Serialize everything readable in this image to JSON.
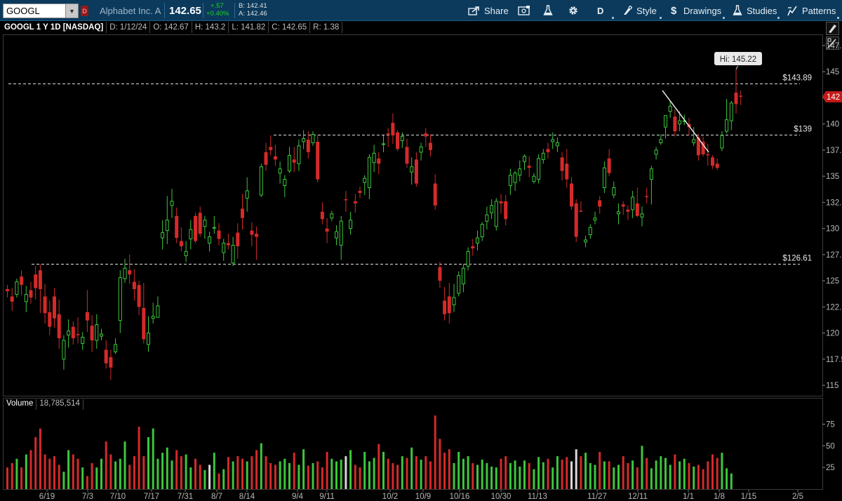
{
  "toolbar": {
    "symbol": "GOOGL",
    "dividend_flag": "D",
    "company": "Alphabet Inc. A",
    "last_price": "142.65",
    "net_change": "+.57",
    "net_change_pct": "+0.40%",
    "bid": "B: 142.41",
    "ask": "A: 142.46",
    "share_label": "Share",
    "aggregation_label": "D",
    "style_label": "Style",
    "drawings_label": "Drawings",
    "studies_label": "Studies",
    "patterns_label": "Patterns",
    "icons": [
      "share-icon",
      "screenshot-icon",
      "flask-icon",
      "gear-icon",
      "style-icon",
      "drawings-icon",
      "studies-icon",
      "patterns-icon"
    ]
  },
  "infobar": {
    "title": "GOOGL 1 Y 1D [NASDAQ]",
    "date": "D: 1/12/24",
    "open": "O: 142.67",
    "high": "H: 143.2",
    "low": "L: 141.82",
    "close": "C: 142.65",
    "range": "R: 1.38"
  },
  "volume_panel": {
    "title": "Volume",
    "value": "18,785,514"
  },
  "colors": {
    "up": "#3dc63d",
    "down": "#d42a2a",
    "neutral": "#d8d8d8",
    "toolbar_bg": "#0b3a5c",
    "last_price_bubble": "#c41919"
  },
  "chart_data": {
    "type": "candlestick",
    "symbol": "GOOGL",
    "period": "1 Y 1D",
    "y_axis": {
      "min": 114,
      "max": 148.5,
      "ticks": [
        115,
        117.5,
        120,
        122.5,
        125,
        127.5,
        130,
        132.5,
        135,
        137.5,
        140,
        142.5,
        145,
        147.5
      ],
      "tick_labels": [
        "115",
        "117.5",
        "120",
        "122.5",
        "125",
        "127.5",
        "130",
        "132.5",
        "135",
        "137.5",
        "140",
        "142",
        "145",
        "147.5"
      ]
    },
    "x_axis": {
      "labels": [
        "6/19",
        "7/3",
        "7/10",
        "7/17",
        "7/31",
        "8/7",
        "8/14",
        "9/4",
        "9/11",
        "10/2",
        "10/9",
        "10/16",
        "10/30",
        "11/13",
        "11/27",
        "12/11",
        "1/1",
        "1/8",
        "1/15",
        "2/5"
      ]
    },
    "volume_axis": {
      "ticks": [
        25,
        50,
        75
      ],
      "max": 90
    },
    "horizontal_lines": [
      {
        "price": 143.89,
        "label": "$143.89"
      },
      {
        "price": 139,
        "label": "$139"
      },
      {
        "price": 126.61,
        "label": "$126.61"
      }
    ],
    "high_marker": {
      "label": "Hi: 145.22",
      "price": 145.22
    },
    "last_price_label": "142",
    "trendline": {
      "from": {
        "date": "12/14",
        "price": 143.2
      },
      "to": {
        "date": "1/2",
        "price": 137.3
      }
    },
    "candles_ohlc": [
      [
        124.2,
        124.6,
        123.4,
        124.0
      ],
      [
        123.5,
        124.3,
        122.1,
        123.0
      ],
      [
        123.7,
        125.2,
        123.4,
        124.9
      ],
      [
        125.4,
        126.0,
        123.6,
        124.6
      ],
      [
        123.0,
        124.5,
        122.0,
        123.7
      ],
      [
        124.1,
        124.9,
        122.8,
        123.4
      ],
      [
        125.6,
        126.4,
        123.2,
        124.3
      ],
      [
        126.0,
        126.6,
        121.9,
        124.2
      ],
      [
        123.5,
        124.7,
        120.9,
        121.9
      ],
      [
        122.0,
        123.1,
        119.8,
        120.6
      ],
      [
        123.5,
        124.3,
        120.5,
        121.4
      ],
      [
        121.8,
        123.2,
        118.5,
        119.5
      ],
      [
        117.5,
        119.8,
        116.5,
        119.3
      ],
      [
        119.8,
        121.3,
        118.6,
        120.2
      ],
      [
        120.6,
        121.1,
        118.9,
        119.5
      ],
      [
        119.9,
        121.5,
        119.0,
        119.8
      ],
      [
        119.0,
        120.1,
        118.4,
        119.6
      ],
      [
        122.0,
        124.1,
        120.1,
        121.2
      ],
      [
        120.7,
        121.7,
        118.2,
        119.3
      ],
      [
        119.3,
        121.8,
        118.5,
        120.8
      ],
      [
        119.7,
        120.4,
        119.3,
        119.9
      ],
      [
        118.4,
        119.3,
        116.6,
        117.1
      ],
      [
        117.7,
        118.4,
        115.5,
        116.7
      ],
      [
        118.2,
        119.5,
        118.0,
        118.9
      ],
      [
        121.2,
        126.0,
        120.0,
        125.3
      ],
      [
        125.2,
        127.1,
        124.8,
        126.2
      ],
      [
        126.0,
        127.5,
        124.7,
        125.6
      ],
      [
        124.9,
        126.1,
        123.1,
        124.2
      ],
      [
        124.6,
        125.0,
        121.7,
        122.5
      ],
      [
        122.4,
        124.8,
        119.0,
        119.4
      ],
      [
        118.9,
        121.6,
        118.2,
        120.0
      ],
      [
        121.4,
        122.9,
        120.9,
        121.6
      ],
      [
        121.5,
        123.5,
        121.5,
        122.6
      ],
      [
        129.1,
        130.8,
        128.0,
        129.6
      ],
      [
        129.8,
        133.1,
        128.5,
        130.8
      ],
      [
        132.2,
        133.8,
        131.0,
        132.6
      ],
      [
        131.2,
        132.0,
        128.6,
        129.1
      ],
      [
        128.8,
        130.1,
        127.8,
        128.3
      ],
      [
        127.4,
        128.8,
        126.8,
        127.8
      ],
      [
        129.0,
        130.8,
        128.0,
        129.9
      ],
      [
        131.2,
        131.5,
        128.6,
        128.8
      ],
      [
        131.5,
        132.1,
        129.2,
        129.5
      ],
      [
        130.2,
        131.2,
        129.0,
        130.8
      ],
      [
        128.6,
        129.7,
        127.8,
        129.2
      ],
      [
        130.1,
        131.2,
        129.5,
        130.1
      ],
      [
        129.8,
        130.5,
        128.4,
        129.0
      ],
      [
        127.7,
        129.0,
        126.9,
        128.6
      ],
      [
        128.6,
        129.5,
        128.0,
        128.4
      ],
      [
        126.7,
        129.2,
        126.4,
        128.4
      ],
      [
        129.6,
        130.5,
        127.1,
        128.3
      ],
      [
        131.9,
        133.3,
        129.9,
        131.0
      ],
      [
        132.9,
        134.9,
        131.6,
        133.6
      ],
      [
        129.8,
        130.6,
        128.3,
        129.4
      ],
      [
        129.5,
        130.2,
        127.0,
        129.2
      ],
      [
        133.2,
        136.2,
        133.0,
        135.9
      ],
      [
        137.3,
        138.2,
        135.5,
        136.1
      ],
      [
        137.8,
        138.9,
        137.0,
        137.5
      ],
      [
        136.9,
        138.0,
        136.0,
        136.6
      ],
      [
        135.3,
        136.4,
        134.3,
        135.7
      ],
      [
        134.1,
        135.1,
        133.0,
        134.7
      ],
      [
        135.5,
        137.8,
        135.3,
        137.0
      ],
      [
        136.6,
        137.8,
        135.4,
        136.3
      ],
      [
        136.2,
        138.5,
        135.5,
        137.9
      ],
      [
        138.3,
        139.4,
        137.6,
        138.6
      ],
      [
        138.5,
        139.3,
        136.7,
        137.3
      ],
      [
        138.2,
        139.3,
        137.9,
        139.0
      ],
      [
        138.3,
        138.9,
        134.4,
        134.7
      ],
      [
        131.6,
        132.5,
        130.4,
        130.9
      ],
      [
        130.0,
        131.0,
        128.6,
        129.7
      ],
      [
        131.0,
        131.7,
        130.7,
        131.4
      ],
      [
        129.1,
        130.3,
        128.4,
        129.7
      ],
      [
        128.4,
        131.2,
        127.0,
        130.7
      ],
      [
        132.8,
        133.6,
        131.6,
        132.7
      ],
      [
        130.0,
        131.6,
        129.4,
        130.8
      ],
      [
        132.6,
        133.3,
        131.5,
        132.4
      ],
      [
        133.6,
        134.0,
        132.9,
        133.4
      ],
      [
        134.4,
        135.1,
        133.2,
        134.8
      ],
      [
        133.9,
        137.1,
        132.8,
        136.8
      ],
      [
        136.3,
        138.0,
        135.4,
        137.2
      ],
      [
        136.7,
        137.3,
        135.2,
        136.2
      ],
      [
        138.1,
        138.9,
        137.3,
        138.1
      ],
      [
        139.1,
        139.6,
        137.8,
        139.0
      ],
      [
        140.1,
        141.0,
        138.1,
        138.9
      ],
      [
        139.2,
        139.4,
        137.4,
        137.6
      ],
      [
        138.4,
        139.2,
        137.7,
        138.8
      ],
      [
        137.8,
        138.6,
        135.8,
        136.2
      ],
      [
        135.4,
        136.8,
        134.2,
        135.9
      ],
      [
        136.6,
        137.3,
        134.0,
        134.3
      ],
      [
        137.3,
        138.2,
        136.5,
        137.8
      ],
      [
        139.1,
        139.6,
        137.8,
        138.8
      ],
      [
        138.2,
        139.0,
        136.9,
        137.5
      ],
      [
        134.3,
        135.2,
        131.8,
        132.2
      ],
      [
        126.3,
        126.8,
        124.3,
        125.0
      ],
      [
        123.1,
        124.4,
        121.2,
        121.8
      ],
      [
        123.5,
        124.8,
        120.9,
        121.9
      ],
      [
        122.7,
        124.7,
        122.0,
        123.4
      ],
      [
        123.8,
        125.9,
        123.5,
        125.5
      ],
      [
        124.7,
        126.6,
        123.9,
        126.2
      ],
      [
        126.4,
        128.2,
        126.0,
        127.8
      ],
      [
        128.3,
        129.0,
        127.4,
        128.1
      ],
      [
        128.6,
        129.8,
        127.9,
        129.1
      ],
      [
        129.2,
        130.6,
        128.8,
        130.4
      ],
      [
        130.7,
        132.1,
        129.9,
        131.3
      ],
      [
        131.5,
        132.8,
        130.9,
        132.2
      ],
      [
        130.2,
        132.9,
        129.8,
        132.6
      ],
      [
        132.6,
        133.3,
        131.4,
        132.4
      ],
      [
        132.6,
        133.2,
        130.3,
        130.9
      ],
      [
        134.1,
        135.7,
        133.2,
        135.1
      ],
      [
        134.4,
        135.5,
        133.6,
        135.3
      ],
      [
        135.1,
        136.5,
        134.5,
        135.7
      ],
      [
        136.4,
        137.1,
        135.6,
        136.9
      ],
      [
        136.0,
        136.9,
        134.9,
        135.8
      ],
      [
        134.5,
        135.3,
        134.3,
        135.0
      ],
      [
        134.7,
        137.1,
        134.3,
        136.7
      ],
      [
        136.6,
        137.6,
        136.2,
        137.2
      ],
      [
        137.6,
        138.2,
        136.7,
        137.3
      ],
      [
        138.3,
        139.2,
        137.6,
        138.5
      ],
      [
        137.9,
        138.7,
        137.3,
        138.2
      ],
      [
        136.8,
        137.3,
        134.6,
        135.5
      ],
      [
        136.2,
        137.6,
        133.9,
        134.7
      ],
      [
        134.3,
        134.9,
        131.8,
        132.1
      ],
      [
        132.4,
        132.8,
        128.7,
        129.2
      ],
      [
        131.7,
        132.6,
        131.6,
        131.6
      ],
      [
        128.7,
        129.3,
        128.2,
        128.9
      ],
      [
        129.4,
        130.4,
        129.0,
        130.1
      ],
      [
        130.8,
        131.6,
        130.4,
        131.0
      ],
      [
        132.7,
        133.1,
        131.4,
        132.1
      ],
      [
        133.9,
        136.4,
        133.4,
        135.8
      ],
      [
        136.7,
        137.6,
        135.0,
        135.3
      ],
      [
        133.2,
        134.5,
        132.9,
        133.9
      ],
      [
        131.4,
        132.4,
        130.4,
        131.6
      ],
      [
        132.3,
        132.6,
        131.3,
        132.1
      ],
      [
        131.8,
        132.2,
        130.8,
        131.6
      ],
      [
        131.8,
        133.6,
        131.0,
        133.0
      ],
      [
        132.4,
        133.9,
        131.1,
        131.2
      ],
      [
        131.1,
        132.1,
        130.2,
        131.4
      ],
      [
        133.1,
        133.9,
        132.4,
        133.0
      ],
      [
        134.7,
        136.0,
        132.3,
        135.7
      ],
      [
        137.1,
        137.8,
        136.6,
        137.5
      ],
      [
        138.2,
        139.0,
        138.0,
        138.5
      ],
      [
        139.7,
        140.8,
        138.6,
        140.8
      ],
      [
        141.2,
        142.2,
        140.6,
        141.7
      ],
      [
        140.7,
        141.4,
        138.8,
        139.3
      ],
      [
        140.0,
        141.2,
        139.3,
        140.3
      ],
      [
        140.3,
        140.9,
        139.9,
        140.3
      ],
      [
        140.0,
        140.6,
        138.9,
        139.7
      ],
      [
        138.2,
        139.7,
        137.9,
        138.5
      ],
      [
        138.7,
        139.0,
        136.5,
        137.0
      ],
      [
        138.3,
        138.8,
        136.9,
        137.1
      ],
      [
        137.1,
        138.1,
        136.0,
        137.0
      ],
      [
        136.8,
        137.0,
        135.7,
        136.0
      ],
      [
        136.2,
        136.7,
        135.6,
        135.8
      ],
      [
        137.7,
        139.3,
        137.4,
        138.9
      ],
      [
        139.3,
        142.4,
        139.1,
        140.4
      ],
      [
        140.3,
        142.2,
        139.4,
        142.0
      ],
      [
        143.0,
        145.2,
        141.0,
        141.9
      ],
      [
        142.7,
        143.2,
        141.8,
        142.6
      ]
    ],
    "volumes_m": [
      25,
      30,
      35,
      25,
      40,
      45,
      60,
      70,
      40,
      35,
      38,
      28,
      20,
      45,
      40,
      35,
      25,
      15,
      30,
      25,
      35,
      55,
      40,
      32,
      35,
      55,
      28,
      38,
      72,
      38,
      60,
      70,
      35,
      42,
      48,
      33,
      45,
      38,
      40,
      25,
      35,
      28,
      22,
      28,
      42,
      18,
      23,
      37,
      32,
      38,
      35,
      32,
      38,
      45,
      53,
      38,
      30,
      28,
      32,
      35,
      30,
      42,
      28,
      46,
      27,
      30,
      32,
      25,
      43,
      35,
      32,
      34,
      38,
      45,
      28,
      25,
      43,
      32,
      36,
      52,
      43,
      35,
      30,
      28,
      38,
      36,
      48,
      38,
      34,
      38,
      32,
      85,
      58,
      42,
      46,
      30,
      43,
      35,
      38,
      30,
      28,
      34,
      30,
      26,
      25,
      35,
      38,
      30,
      33,
      26,
      33,
      30,
      23,
      37,
      31,
      35,
      25,
      38,
      34,
      37,
      32,
      46,
      38,
      42,
      30,
      28,
      43,
      32,
      32,
      25,
      28,
      38,
      30,
      33,
      25,
      50,
      36,
      24,
      33,
      38,
      36,
      28,
      40,
      32,
      35,
      30,
      26,
      28,
      23,
      32,
      40,
      36,
      42,
      24,
      18
    ],
    "volume_white_indices": [
      43,
      72,
      120,
      121
    ]
  }
}
